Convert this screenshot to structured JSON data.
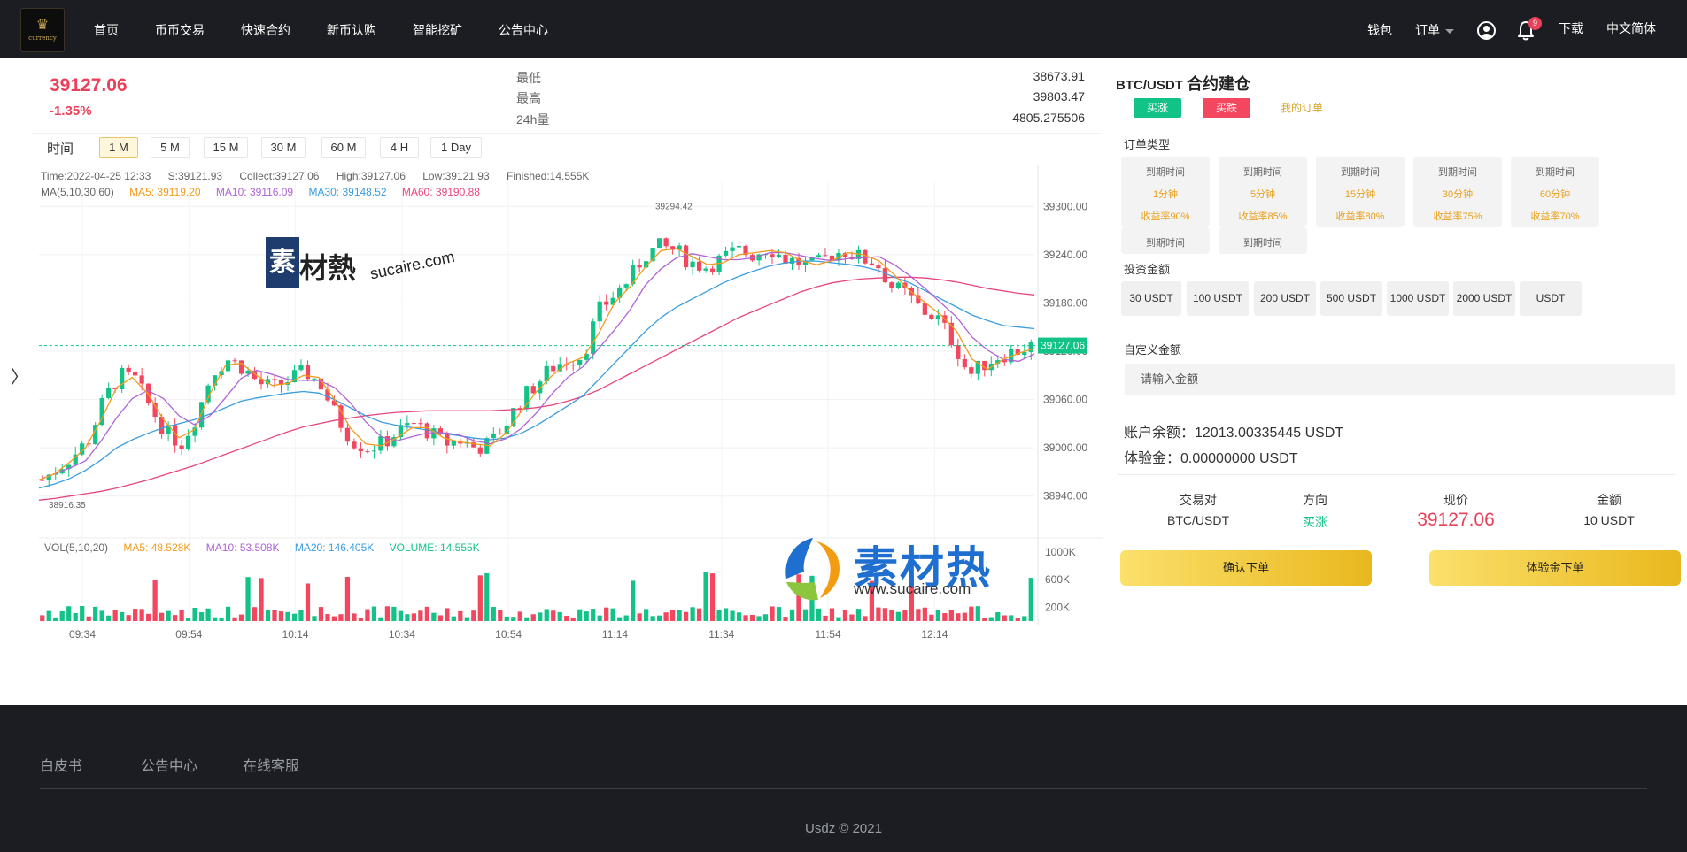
{
  "brand": {
    "logo_text": "currency"
  },
  "nav": {
    "items": [
      {
        "label": "首页"
      },
      {
        "label": "币币交易"
      },
      {
        "label": "快速合约"
      },
      {
        "label": "新币认购"
      },
      {
        "label": "智能挖矿"
      },
      {
        "label": "公告中心"
      }
    ],
    "wallet": "钱包",
    "orders": "订单",
    "notification_count": "9",
    "download": "下载",
    "language": "中文简体"
  },
  "ticker": {
    "price": "39127.06",
    "change": "-1.35%",
    "low_label": "最低",
    "low_value": "38673.91",
    "high_label": "最高",
    "high_value": "39803.47",
    "vol_label": "24h量",
    "vol_value": "4805.275506"
  },
  "intervals": {
    "label": "时间",
    "items": [
      "1 M",
      "5 M",
      "15 M",
      "30 M",
      "60 M",
      "4 H",
      "1 Day"
    ],
    "active": "1 M"
  },
  "chart_info": {
    "time": "Time:2022-04-25 12:33",
    "s": "S:39121.93",
    "collect": "Collect:39127.06",
    "high": "High:39127.06",
    "low": "Low:39121.93",
    "finished": "Finished:14.555K",
    "ma_title": "MA(5,10,30,60)",
    "ma5": "MA5: 39119.20",
    "ma10": "MA10: 39116.09",
    "ma30": "MA30: 39148.52",
    "ma60": "MA60: 39190.88",
    "vol_title": "VOL(5,10,20)",
    "vol_ma5": "MA5: 48.528K",
    "vol_ma10": "MA10: 53.508K",
    "vol_ma20": "MA20: 146.405K",
    "vol_volume": "VOLUME: 14.555K"
  },
  "chart_data": {
    "type": "candlestick",
    "price_axis_ticks": [
      "39300.00",
      "39240.00",
      "39180.00",
      "39120.00",
      "39060.00",
      "39000.00",
      "38940.00"
    ],
    "volume_axis_ticks": [
      "1000K",
      "600K",
      "200K"
    ],
    "time_ticks": [
      "09:34",
      "09:54",
      "10:14",
      "10:34",
      "10:54",
      "11:14",
      "11:34",
      "11:54",
      "12:14"
    ],
    "max_label": "39294.42",
    "min_label": "38916.35",
    "last_price_tag": "39127.06",
    "ylim": [
      38910,
      39330
    ],
    "price_trend": [
      38960,
      38975,
      38990,
      39010,
      39060,
      39090,
      39085,
      39050,
      39020,
      39005,
      39040,
      39095,
      39110,
      39100,
      39080,
      39075,
      39085,
      39095,
      39080,
      39040,
      39010,
      39000,
      39005,
      39020,
      39030,
      39020,
      39005,
      39010,
      39000,
      39005,
      39030,
      39060,
      39080,
      39100,
      39110,
      39115,
      39170,
      39190,
      39210,
      39240,
      39250,
      39245,
      39230,
      39225,
      39235,
      39245,
      39240,
      39250,
      39235,
      39230,
      39225,
      39240,
      39245,
      39235,
      39230,
      39200,
      39190,
      39170,
      39160,
      39130,
      39090,
      39105,
      39115,
      39120,
      39127
    ],
    "ma30": [
      38950,
      38955,
      38962,
      38972,
      38985,
      39000,
      39010,
      39018,
      39025,
      39030,
      39035,
      39042,
      39050,
      39058,
      39062,
      39065,
      39068,
      39070,
      39068,
      39060,
      39050,
      39040,
      39032,
      39028,
      39025,
      39022,
      39018,
      39015,
      39012,
      39010,
      39012,
      39018,
      39028,
      39040,
      39052,
      39065,
      39085,
      39105,
      39125,
      39145,
      39162,
      39175,
      39185,
      39195,
      39205,
      39213,
      39220,
      39226,
      39230,
      39232,
      39232,
      39230,
      39228,
      39225,
      39220,
      39212,
      39205,
      39195,
      39185,
      39175,
      39165,
      39158,
      39152,
      39150,
      39148
    ],
    "ma60": [
      38935,
      38937,
      38940,
      38943,
      38946,
      38950,
      38955,
      38960,
      38966,
      38972,
      38978,
      38985,
      38992,
      38999,
      39006,
      39013,
      39020,
      39026,
      39030,
      39034,
      39037,
      39040,
      39042,
      39044,
      39045,
      39046,
      39046,
      39046,
      39046,
      39046,
      39047,
      39048,
      39050,
      39053,
      39058,
      39064,
      39072,
      39082,
      39092,
      39102,
      39112,
      39122,
      39132,
      39142,
      39152,
      39162,
      39170,
      39178,
      39186,
      39194,
      39200,
      39205,
      39208,
      39210,
      39211,
      39212,
      39212,
      39211,
      39209,
      39206,
      39202,
      39198,
      39195,
      39192,
      39190
    ]
  },
  "trade": {
    "pair": "BTC/USDT",
    "title": "合约建仓",
    "buy_up": "买涨",
    "buy_down": "买跌",
    "my_orders": "我的订单",
    "order_type_label": "订单类型",
    "order_types": [
      {
        "t": "到期时间",
        "dur": "1分钟",
        "rate": "收益率90%"
      },
      {
        "t": "到期时间",
        "dur": "5分钟",
        "rate": "收益率85%"
      },
      {
        "t": "到期时间",
        "dur": "15分钟",
        "rate": "收益率80%"
      },
      {
        "t": "到期时间",
        "dur": "30分钟",
        "rate": "收益率75%"
      },
      {
        "t": "到期时间",
        "dur": "60分钟",
        "rate": "收益率70%"
      },
      {
        "t": "到期时间"
      },
      {
        "t": "到期时间"
      }
    ],
    "invest_label": "投资金额",
    "amounts": [
      "30 USDT",
      "100 USDT",
      "200 USDT",
      "500 USDT",
      "1000 USDT",
      "2000 USDT",
      "USDT"
    ],
    "custom_label": "自定义金额",
    "custom_placeholder": "请输入金额",
    "balance": "账户余额：12013.00335445 USDT",
    "trial": "体验金：0.00000000 USDT",
    "summary": {
      "pair_label": "交易对",
      "pair_value": "BTC/USDT",
      "dir_label": "方向",
      "dir_value": "买涨",
      "price_label": "现价",
      "price_value": "39127.06",
      "amount_label": "金额",
      "amount_value": "10 USDT"
    },
    "confirm": "确认下单",
    "trial_order": "体验金下单"
  },
  "footer": {
    "links": [
      "白皮书",
      "公告中心",
      "在线客服"
    ],
    "copyright": "Usdz © 2021"
  },
  "watermark": {
    "box": "素",
    "text1": "材熱",
    "url1": "sucaire.com",
    "text2": "素材热",
    "url2": "www.sucaire.com"
  },
  "colors": {
    "up": "#13c287",
    "down": "#f2475f",
    "ma5": "#f29a1c",
    "ma10": "#b063d6",
    "ma30": "#3a9de0",
    "ma60": "#e8457a",
    "gold": "#e9b81e"
  }
}
